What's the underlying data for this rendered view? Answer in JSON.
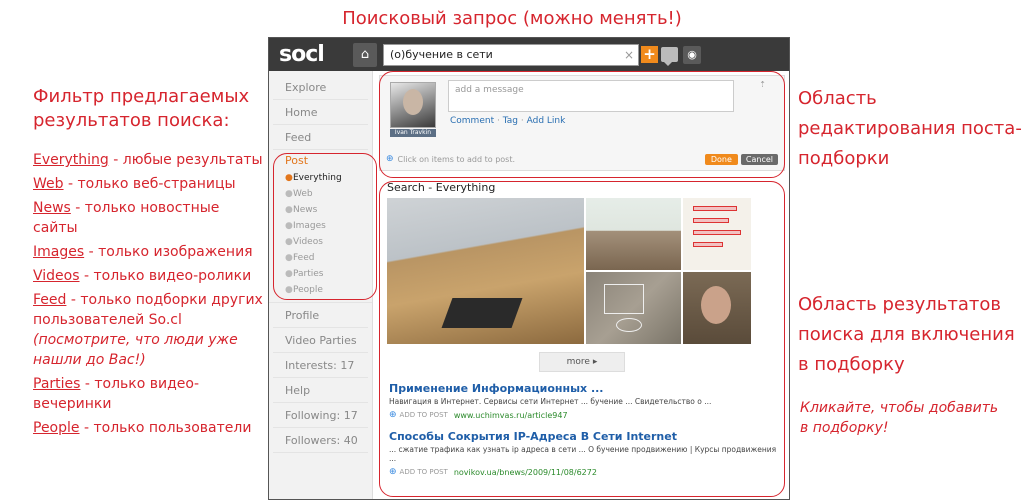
{
  "annotations": {
    "top": "Поисковый запрос (можно менять!)",
    "left_title": "Фильтр предлагаемых результатов поиска:",
    "filters": [
      {
        "key": "Everything",
        "desc": " - любые результаты",
        "note": ""
      },
      {
        "key": "Web",
        "desc": " - только веб-страницы",
        "note": ""
      },
      {
        "key": "News",
        "desc": " - только новостные сайты",
        "note": ""
      },
      {
        "key": "Images",
        "desc": " - только изображения",
        "note": ""
      },
      {
        "key": "Videos",
        "desc": " - только видео-ролики",
        "note": ""
      },
      {
        "key": "Feed",
        "desc": " - только подборки других пользователей So.cl",
        "note": "(посмотрите, что люди уже нашли до Вас!)"
      },
      {
        "key": "Parties",
        "desc": " - только видео-вечеринки",
        "note": ""
      },
      {
        "key": "People",
        "desc": " - только пользователи",
        "note": ""
      }
    ],
    "right_edit": "Область редактирования поста-подборки",
    "right_results": "Область результатов поиска для включения в подборку",
    "click_hint": "Кликайте, чтобы добавить в подборку!"
  },
  "app": {
    "logo": "socl",
    "search_query": "(о)бучение в сети",
    "sidebar": {
      "nav_top": [
        "Explore",
        "Home",
        "Feed"
      ],
      "post_label": "Post",
      "post_items": [
        "Everything",
        "Web",
        "News",
        "Images",
        "Videos",
        "Feed",
        "Parties",
        "People"
      ],
      "active_item": "Everything",
      "nav_bottom": [
        "Profile",
        "Video Parties",
        "Interests: 17",
        "Help",
        "Following: 17",
        "Followers: 40"
      ]
    },
    "composer": {
      "placeholder": "add a message",
      "user_name": "Ivan Travkin",
      "links": [
        "Comment",
        "Tag",
        "Add Link"
      ],
      "hint": "Click on items to add to post.",
      "done": "Done",
      "cancel": "Cancel"
    },
    "results": {
      "title": "Search - Everything",
      "more": "more",
      "items": [
        {
          "title": "Применение Информационных ...",
          "snippet": "Навигация в Интернет. Сервисы сети Интернет ... бучение ... Свидетельство о ...",
          "add": "ADD TO POST",
          "url": "www.uchimvas.ru/article947"
        },
        {
          "title": "Способы Сокрытия IP-Адреса В Сети Internet",
          "snippet": "... сжатие трафика как узнать ip адреса в сети ... О бучение продвижению | Курсы продвижения ...",
          "add": "ADD TO POST",
          "url": "novikov.ua/bnews/2009/11/08/6272"
        }
      ]
    }
  }
}
